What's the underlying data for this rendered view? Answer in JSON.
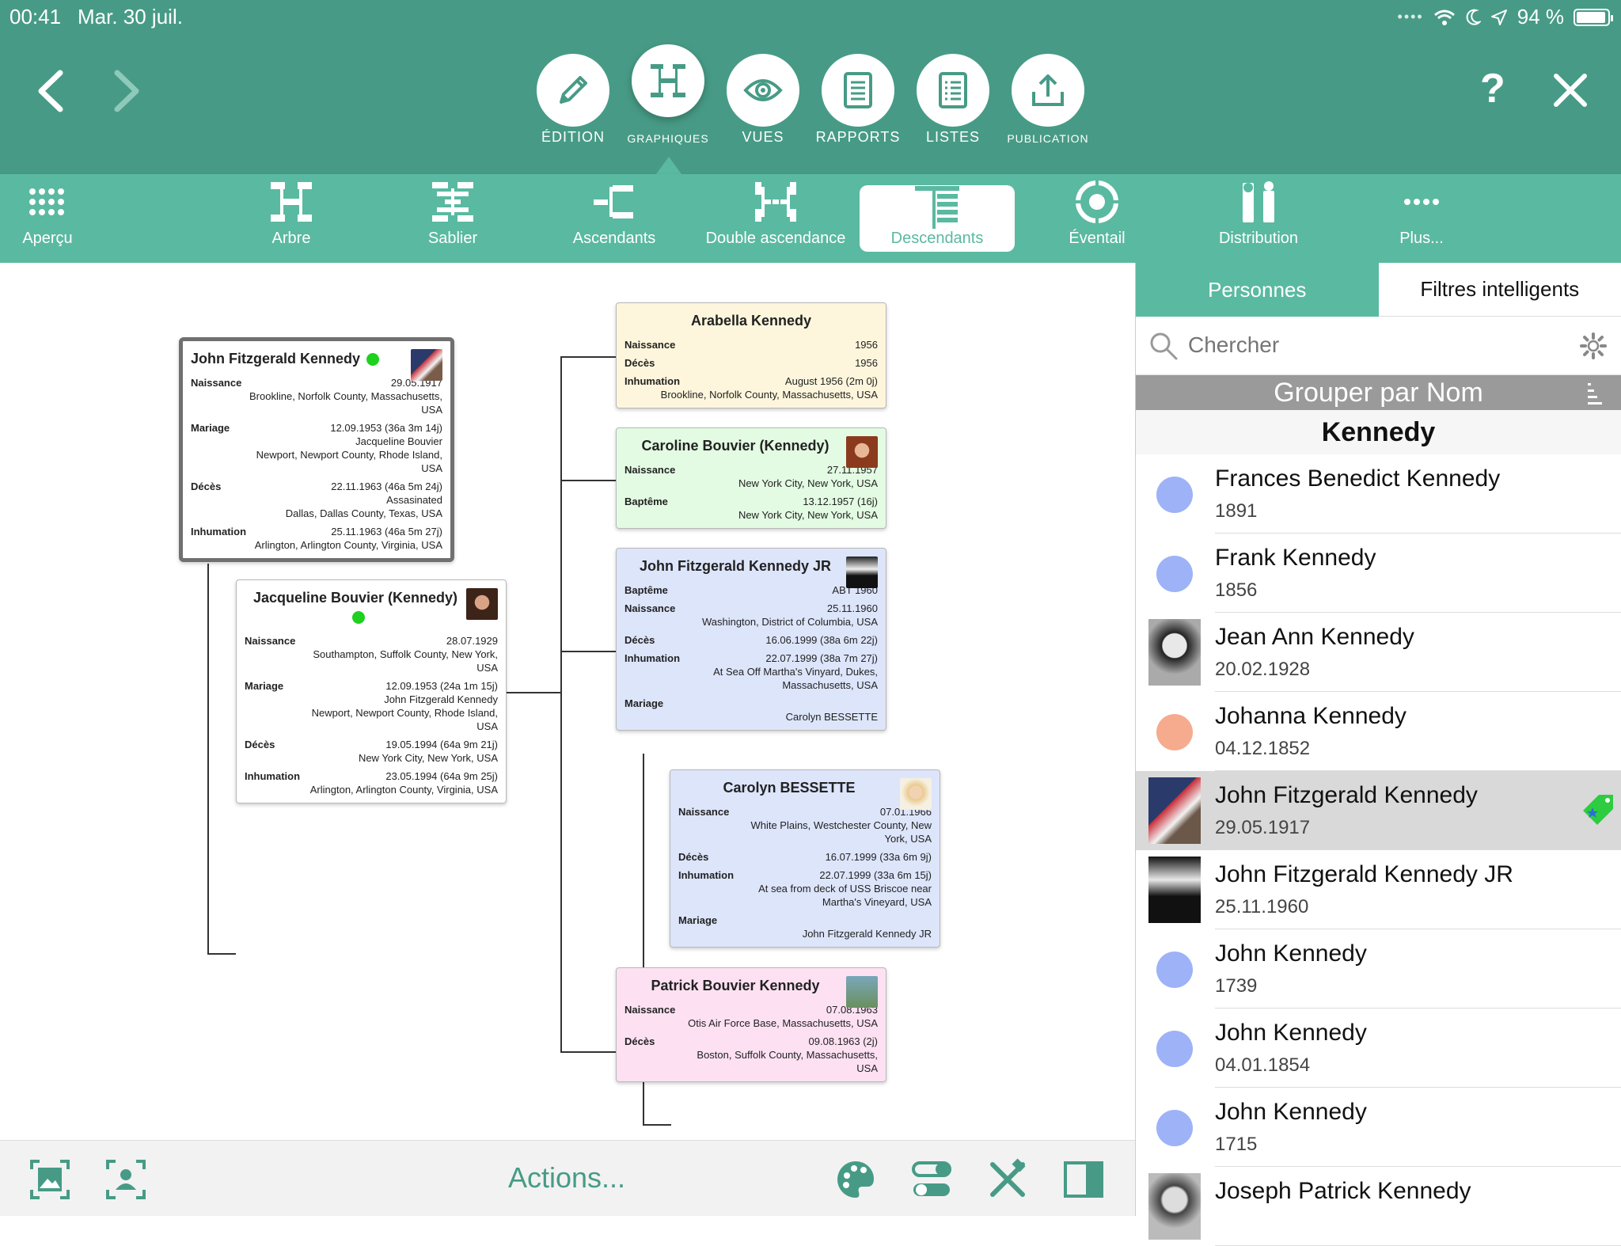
{
  "status": {
    "time": "00:41",
    "date": "Mar. 30 juil.",
    "battery": "94 %"
  },
  "main_tabs": [
    {
      "id": "edition",
      "label": "ÉDITION"
    },
    {
      "id": "graphiques",
      "label": "GRAPHIQUES"
    },
    {
      "id": "vues",
      "label": "VUES"
    },
    {
      "id": "rapports",
      "label": "RAPPORTS"
    },
    {
      "id": "listes",
      "label": "LISTES"
    },
    {
      "id": "publication",
      "label": "PUBLICATION"
    }
  ],
  "help_label": "?",
  "sub_tabs": [
    {
      "label": "Aperçu",
      "icon": "grid-icon"
    },
    {
      "label": "Arbre",
      "icon": "tree-chart-icon"
    },
    {
      "label": "Sablier",
      "icon": "hourglass-chart-icon"
    },
    {
      "label": "Ascendants",
      "icon": "ancestors-chart-icon"
    },
    {
      "label": "Double ascendance",
      "icon": "double-ancestry-icon"
    },
    {
      "label": "Descendants",
      "icon": "descendants-chart-icon"
    },
    {
      "label": "Éventail",
      "icon": "fan-chart-icon"
    },
    {
      "label": "Distribution",
      "icon": "distribution-chart-icon"
    },
    {
      "label": "Plus...",
      "icon": "more-icon"
    }
  ],
  "chart": {
    "root": {
      "name": "John Fitzgerald Kennedy",
      "events": [
        {
          "k": "Naissance",
          "v": "29.05.1917",
          "sub": [
            "Brookline, Norfolk County, Massachusetts,",
            "USA"
          ]
        },
        {
          "k": "Mariage",
          "v": "12.09.1953 (36a 3m 14j)",
          "sub": [
            "Jacqueline Bouvier",
            "Newport, Newport County, Rhode Island,",
            "USA"
          ]
        },
        {
          "k": "Décès",
          "v": "22.11.1963 (46a 5m 24j)",
          "sub": [
            "Assasinated",
            "Dallas, Dallas County, Texas, USA"
          ]
        },
        {
          "k": "Inhumation",
          "v": "25.11.1963 (46a 5m 27j)",
          "sub": [
            "Arlington, Arlington County, Virginia, USA"
          ]
        }
      ]
    },
    "spouse": {
      "name": "Jacqueline Bouvier (Kennedy)",
      "events": [
        {
          "k": "Naissance",
          "v": "28.07.1929",
          "sub": [
            "Southampton, Suffolk County, New York,",
            "USA"
          ]
        },
        {
          "k": "Mariage",
          "v": "12.09.1953 (24a 1m 15j)",
          "sub": [
            "John Fitzgerald Kennedy",
            "Newport, Newport County, Rhode Island,",
            "USA"
          ]
        },
        {
          "k": "Décès",
          "v": "19.05.1994 (64a 9m 21j)",
          "sub": [
            "New York City, New York, USA"
          ]
        },
        {
          "k": "Inhumation",
          "v": "23.05.1994 (64a 9m 25j)",
          "sub": [
            "Arlington, Arlington County, Virginia, USA"
          ]
        }
      ]
    },
    "children": [
      {
        "name": "Arabella Kennedy",
        "events": [
          {
            "k": "Naissance",
            "v": "1956",
            "sub": []
          },
          {
            "k": "Décès",
            "v": "1956",
            "sub": []
          },
          {
            "k": "Inhumation",
            "v": "August 1956 (2m 0j)",
            "sub": [
              "Brookline, Norfolk County, Massachusetts, USA"
            ]
          }
        ]
      },
      {
        "name": "Caroline Bouvier (Kennedy)",
        "events": [
          {
            "k": "Naissance",
            "v": "27.11.1957",
            "sub": [
              "New York City, New York, USA"
            ]
          },
          {
            "k": "Baptême",
            "v": "13.12.1957 (16j)",
            "sub": [
              "New York City, New York, USA"
            ]
          }
        ]
      },
      {
        "name": "John Fitzgerald Kennedy JR",
        "events": [
          {
            "k": "Baptême",
            "v": "ABT 1960",
            "sub": []
          },
          {
            "k": "Naissance",
            "v": "25.11.1960",
            "sub": [
              "Washington, District of Columbia, USA"
            ]
          },
          {
            "k": "Décès",
            "v": "16.06.1999 (38a 6m 22j)",
            "sub": []
          },
          {
            "k": "Inhumation",
            "v": "22.07.1999 (38a 7m 27j)",
            "sub": [
              "At Sea Off Martha's Vinyard, Dukes,",
              "Massachusetts, USA"
            ]
          },
          {
            "k": "Mariage",
            "v": "",
            "sub": [
              "Carolyn BESSETTE"
            ]
          }
        ]
      },
      {
        "name": "Patrick Bouvier Kennedy",
        "events": [
          {
            "k": "Naissance",
            "v": "07.08.1963",
            "sub": [
              "Otis Air Force Base, Massachusetts, USA"
            ]
          },
          {
            "k": "Décès",
            "v": "09.08.1963 (2j)",
            "sub": [
              "Boston, Suffolk County, Massachusetts,",
              "USA"
            ]
          }
        ]
      }
    ],
    "grand_spouse": {
      "name": "Carolyn BESSETTE",
      "events": [
        {
          "k": "Naissance",
          "v": "07.01.1966",
          "sub": [
            "White Plains, Westchester County, New",
            "York, USA"
          ]
        },
        {
          "k": "Décès",
          "v": "16.07.1999 (33a 6m 9j)",
          "sub": []
        },
        {
          "k": "Inhumation",
          "v": "22.07.1999 (33a 6m 15j)",
          "sub": [
            "At sea from deck of USS Briscoe near",
            "Martha's Vineyard, USA"
          ]
        },
        {
          "k": "Mariage",
          "v": "",
          "sub": [
            "John Fitzgerald Kennedy JR"
          ]
        }
      ]
    }
  },
  "bottom": {
    "actions_label": "Actions..."
  },
  "panel": {
    "tabs": [
      "Personnes",
      "Filtres intelligents"
    ],
    "search_placeholder": "Chercher",
    "group_label": "Grouper par Nom",
    "group_header": "Kennedy",
    "persons": [
      {
        "name": "Frances Benedict Kennedy",
        "date": "1891",
        "avatar": "#9db2f7",
        "photo": false
      },
      {
        "name": "Frank Kennedy",
        "date": "1856",
        "avatar": "#9db2f7",
        "photo": false
      },
      {
        "name": "Jean Ann Kennedy",
        "date": "20.02.1928",
        "avatar": "",
        "photo": true
      },
      {
        "name": "Johanna Kennedy",
        "date": "04.12.1852",
        "avatar": "#f6ab8e",
        "photo": false
      },
      {
        "name": "John Fitzgerald Kennedy",
        "date": "29.05.1917",
        "avatar": "",
        "photo": true,
        "selected": true
      },
      {
        "name": "John Fitzgerald Kennedy JR",
        "date": "25.11.1960",
        "avatar": "",
        "photo": true
      },
      {
        "name": "John Kennedy",
        "date": "1739",
        "avatar": "#9db2f7",
        "photo": false
      },
      {
        "name": "John Kennedy",
        "date": "04.01.1854",
        "avatar": "#9db2f7",
        "photo": false
      },
      {
        "name": "John Kennedy",
        "date": "1715",
        "avatar": "#9db2f7",
        "photo": false
      },
      {
        "name": "Joseph Patrick Kennedy",
        "date": "",
        "avatar": "",
        "photo": true
      }
    ]
  },
  "colors": {
    "header": "#479b86",
    "subbar": "#5ab9a1",
    "accent": "#479b86"
  }
}
